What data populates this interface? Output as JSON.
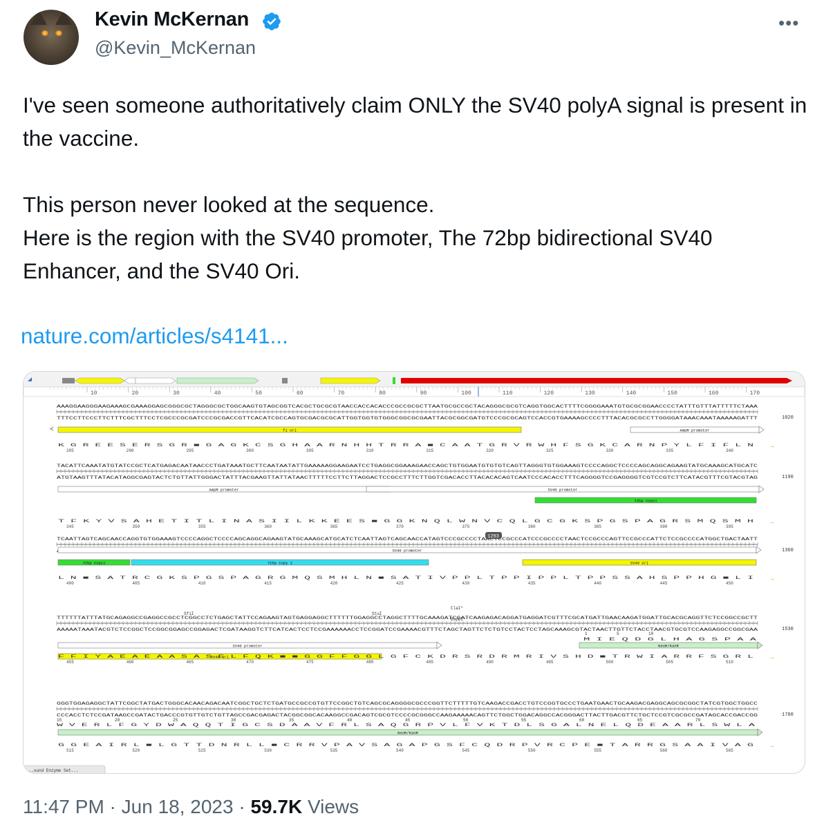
{
  "author": {
    "name": "Kevin McKernan",
    "handle": "@Kevin_McKernan"
  },
  "tweet": {
    "text": "I've seen someone authoritatively claim ONLY the SV40 polyA signal is present in the vaccine.\n\nThis person never looked at the sequence.\nHere is the region with the SV40 promoter, The 72bp bidirectional SV40 Enhancer, and the SV40 Ori.",
    "link": "nature.com/articles/s4141..."
  },
  "footer": {
    "time": "11:47 PM · Jun 18, 2023 · ",
    "views_count": "59.7K",
    "views_label": " Views"
  },
  "sequence_viewer": {
    "ruler_ticks": [
      "10",
      "20",
      "30",
      "40",
      "50",
      "60",
      "70",
      "80",
      "90",
      "100",
      "110",
      "120",
      "130",
      "140",
      "150",
      "160",
      "170"
    ],
    "rows": [
      {
        "index": "1020",
        "top": "AAAGGAAGGGAAGAAAGCGAAAGGAGCGGGCGCTAGGGCGCTGGCAAGTGTAGCGGTCACGCTGCGCGTAACCACCACACCCGCCGCGCTTAATGCGCCGCTACAGGGCGCGTCAGGTGGCACTTTTCGGGGAAATGTGCGCGGAACCCCTATTTGTTTATTTTTCTAAA",
        "bottom": "TTTCCTTCCCTTCTTTCGCTTTCCTCGCCCGCGATCCCGCGACCGTTCACATCGCCAGTGCGACGCGCATTGGTGGTGTGGGCGGCGCGAATTACGCGGCGATGTCCCGCGCAGTCCACCGTGAAAAGCCCCTTTACACGCGCCTTGGGGATAAACAAATAAAAAGATTT",
        "features": [
          {
            "label": "f1 ori"
          },
          {
            "label": "AmpR promoter"
          }
        ],
        "aa": "K  G  R  E  E  S  E  R  S  G  R  ■  G  A  G  K  C  S  G  H  A  A  R  N  H  H  T  R  R  A  ■  C  A  A  T  G  R  V  R  W  H  F  S  G  K  C  A  R  N  P  Y  L  F  I  F  L  N",
        "aa_nums": [
          "285",
          "290",
          "295",
          "300",
          "305",
          "310",
          "315",
          "320",
          "325",
          "330",
          "335",
          "340"
        ]
      },
      {
        "index": "1190",
        "top": "TACATTCAAATATGTATCCGCTCATGAGACAATAACCCTGATAAATGCTTCAATAATATTGAAAAAGGAAGAATCCTGAGGCGGAAAGAACCAGCTGTGGAATGTGTGTCAGTTAGGGTGTGGAAAGTCCCCAGGCTCCCCAGCAGGCAGAAGTATGCAAAGCATGCATC",
        "bottom": "ATGTAAGTTTATACATAGGCGAGTACTCTGTTATTGGGACTATTTACGAAGTTATTATAACTTTTTCCTTCTTAGGACTCCGCCTTTCTTGGTCGACACCTTACACACAGTCAATCCCACACCTTTCAGGGGTCCGAGGGGTCGTCCGTCTTCATACGTTTCGTACGTAG",
        "features": [
          {
            "label": "AmpR promoter"
          },
          {
            "label": "SV40 promoter"
          },
          {
            "label": "72bp Copy1"
          }
        ],
        "aa": "T  F  K  Y  V  S  A  H  E  T  I  T  L  I  N  A  S  I  I  L  K  K  E  E  S  ■  G  G  K  N  Q  L  W  N  V  C  Q  L  G  C  G  K  S  P  G  S  P  A  G  R  S  M  Q  S  M  H",
        "aa_nums": [
          "345",
          "350",
          "355",
          "360",
          "365",
          "370",
          "375",
          "380",
          "385",
          "390",
          "395"
        ]
      },
      {
        "index": "1360",
        "top": "TCAATTAGTCAGCAACCAGGTGTGGAAAGTCCCCAGGCTCCCCAGCAGGCAGAAGTATGCAAAGCATGCATCTCAATTAGTCAGCAACCATAGTCCCGCCCCTAACTCCGCCCATCCCGCCCCTAACTCCGCCCAGTTCCGCCCATTCTCCGCCCCATGGCTGACTAATT",
        "bottom": "AGTTAATCAGTCGTTGGTCCACACCTTTCAGGGGTCCGAGGGGTCGTCCGTCTTCATACGTTTCGTACGTAGAGTTAATCAGTCGTTGGTATCAGGGCGGGGATTGAGGCGGGTAGGGCGGGGATTGAGGCGGGTCAAGGCGGGTAAGAGGCGGGGTACCGACTGATTAA",
        "badge": "1293",
        "features": [
          {
            "label": "SV40 promoter"
          },
          {
            "label": "72bp Copy1"
          },
          {
            "label": "72bp Copy 2"
          },
          {
            "label": "SV40 ori"
          }
        ],
        "aa": "L  N  ■  S  A  T  R  C  G  K  S  P  G  S  P  A  G  R  G  M  Q  S  M  H  L  N  ■  S  A  T  I  V  P  P  L  T  P  P  I  P  P  L  T  P  P  S  S  A  H  S  P  P  H  G  ■  L  I",
        "aa_nums": [
          "400",
          "405",
          "410",
          "415",
          "420",
          "425",
          "430",
          "435",
          "440",
          "445",
          "450"
        ]
      },
      {
        "index": "1530",
        "enzymes": [
          "SfiI",
          "StuI",
          "ClaI*",
          "BspDI*"
        ],
        "top": "TTTTTTATTTATGCAGAGGCCGAGGCCGCCTCGGCCTCTGAGCTATTCCAGAAGTAGTGAGGAGGCTTTTTTGGAGGCCTAGGCTTTTGCAAAGATCGATCAAGAGACAGGATGAGGATCGTTTCGCATGATTGAACAAGATGGATTGCACGCAGGTTCTCCGGCCGCTT",
        "bottom": "AAAAATAAATACGTCTCCGGCTCCGGCGGAGCCGGAGACTCGATAAGGTCTTCATCACTCCTCCGAAAAAACCTCCGGATCCGAAAACGTTTCTAGCTAGTTCTCTGTCCTACTCCTAGCAAAGCGTACTAACTTGTTCTACCTAACGTGCGTCCAAGAGGCCGGCGAA",
        "features": [
          {
            "label": "SV40 promoter"
          },
          {
            "label": "SV40 ori"
          },
          {
            "label": "NeoR/KanR"
          }
        ],
        "neo_aa": "M  I  E  Q  D  G  L  H  A  G  S  P  A  A",
        "neo_nums": [
          "1",
          "5",
          "10"
        ],
        "aa": "F  F  I  Y  A  E  A  E  A  A  S  A  S  E  L  F  Q  K  ■  ■  G  G  F  F  G  G  L  G  F  C  K  D  R  S  R  D  R  M  R  I  V  S  H  D  ■  T  R  W  I  A  R  R  F  S  G  R  L",
        "aa_nums": [
          "455",
          "460",
          "465",
          "470",
          "475",
          "480",
          "485",
          "490",
          "495",
          "500",
          "505",
          "510"
        ]
      },
      {
        "index": "1700",
        "top": "GGGTGGAGAGGCTATTCGGCTATGACTGGGCACAACAGACAATCGGCTGCTCTGATGCCGCCGTGTTCCGGCTGTCAGCGCAGGGGCGCCCGGTTCTTTTTGTCAAGACCGACCTGTCCGGTGCCCTGAATGAACTGCAAGACGAGGCAGCGCGGCTATCGTGGCTGGCC",
        "bottom": "CCCACCTCTCCGATAAGCCGATACTGACCCGTGTTGTCTGTTAGCCGACGAGACTACGGCGGCACAAGGCCGACAGTCGCGTCCCCGCGGGCCAAGAAAAACAGTTCTGGCTGGACAGGCCACGGGACTTACTTGACGTTCTGCTCCGTCGCGCCGATAGCACCGACCGG",
        "neo_nums": [
          "15",
          "20",
          "25",
          "30",
          "35",
          "40",
          "45",
          "50",
          "55",
          "60",
          "65",
          "70"
        ],
        "neo_aa": "W  V  E  R  L  F  G  Y  D  W  A  Q  Q  T  I  G  C  S  D  A  A  V  F  R  L  S  A  Q  G  R  P  V  L  F  V  K  T  D  L  S  G  A  L  N  E  L  Q  D  E  A  A  R  L  S  W  L  A",
        "features": [
          {
            "label": "NeoR/KanR"
          }
        ],
        "aa": "G  G  E  A  I  R  L  ■  L  G  T  T  D  N  R  L  L  ■  C  R  R  V  P  A  V  S  A  G  A  P  G  S  F  C  Q  D  R  P  V  R  C  P  E  ■  T  A  R  R  G  S  A  A  I  V  A  G",
        "aa_nums": [
          "515",
          "520",
          "525",
          "530",
          "535",
          "540",
          "545",
          "550",
          "555",
          "560",
          "565"
        ]
      }
    ],
    "bottom_tab": "...ound Enzyme Set..."
  },
  "colors": {
    "link": "#1d9bf0",
    "verified": "#1d9bf0",
    "map_red": "#e00000",
    "map_yellow": "#f5f500",
    "map_green": "#33dd33",
    "map_cyan": "#33ddee",
    "map_lightgreen": "#c8f0c8"
  }
}
